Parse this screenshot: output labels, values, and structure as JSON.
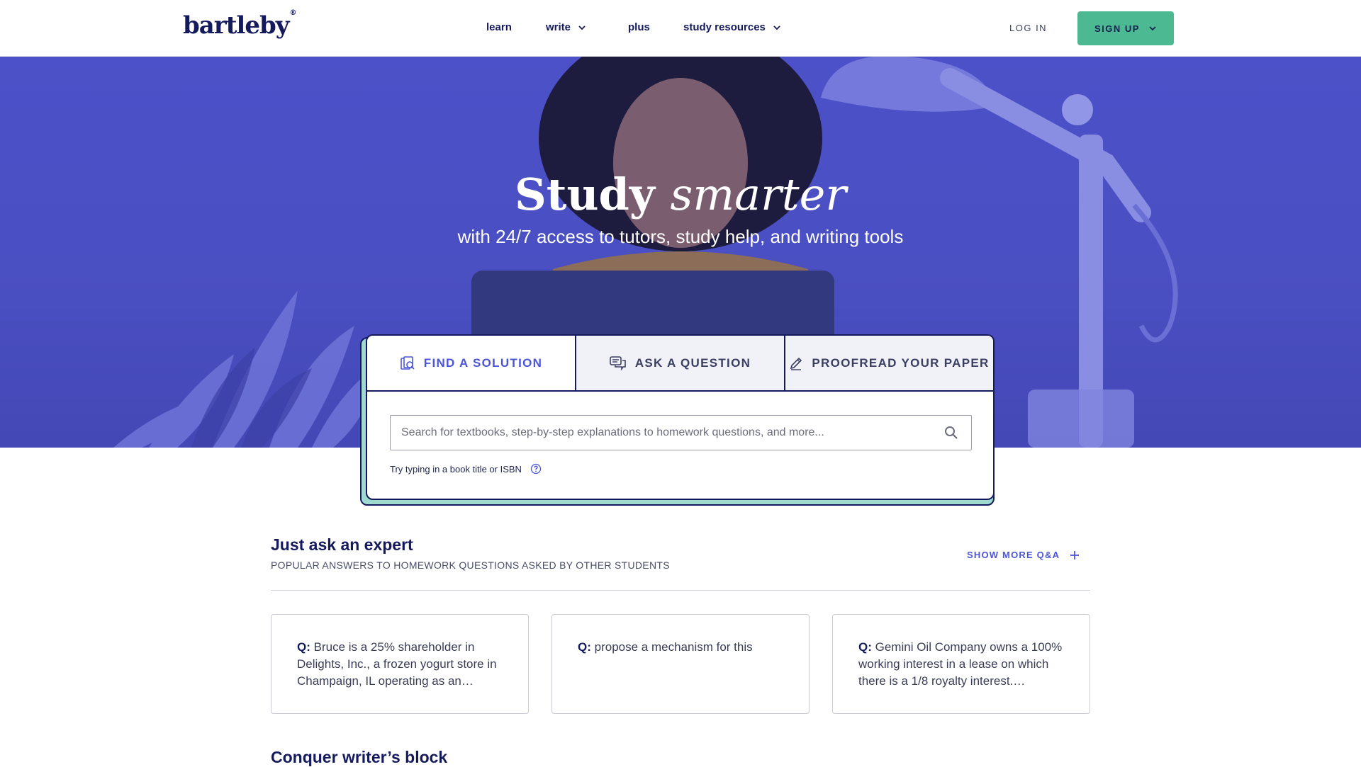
{
  "header": {
    "logo_text": "bartleby",
    "logo_mark": "®",
    "nav": [
      {
        "label": "learn",
        "has_dropdown": false
      },
      {
        "label": "write",
        "has_dropdown": true
      },
      {
        "label": "plus",
        "has_dropdown": false
      },
      {
        "label": "study resources",
        "has_dropdown": true
      }
    ],
    "login_label": "LOG IN",
    "signup_label": "SIGN UP"
  },
  "hero": {
    "title_plain": "Study",
    "title_italic": "smarter",
    "subtitle": "with 24/7 access to tutors, study help, and writing tools"
  },
  "search_card": {
    "tabs": [
      {
        "label": "FIND A SOLUTION",
        "icon": "find-solution-icon",
        "active": true
      },
      {
        "label": "ASK A QUESTION",
        "icon": "chat-bubbles-icon",
        "active": false
      },
      {
        "label": "PROOFREAD YOUR PAPER",
        "icon": "pencil-icon",
        "active": false
      }
    ],
    "search_placeholder": "Search for textbooks, step-by-step explanations to homework questions, and more...",
    "search_value": "",
    "hint": "Try typing in a book title or ISBN"
  },
  "expert": {
    "title": "Just ask an expert",
    "subtitle": "POPULAR ANSWERS TO HOMEWORK QUESTIONS ASKED BY OTHER STUDENTS",
    "show_more_label": "SHOW MORE Q&A",
    "q_prefix": "Q:",
    "questions": [
      {
        "text": "Bruce is a 25% shareholder in Delights, Inc., a frozen yogurt store in Champaign, IL operating as an…"
      },
      {
        "text": "propose a mechanism for this"
      },
      {
        "text": "Gemini Oil Company owns a 100% working interest in a lease on which there is a 1/8 royalty interest.…"
      }
    ]
  },
  "next_section": {
    "title": "Conquer writer’s block"
  },
  "colors": {
    "brand_navy": "#151a5c",
    "hero_purple": "#4c51c9",
    "signup_green": "#4db993",
    "accent_blue": "#4c55d8",
    "card_shadow_teal": "#9fdad0"
  }
}
